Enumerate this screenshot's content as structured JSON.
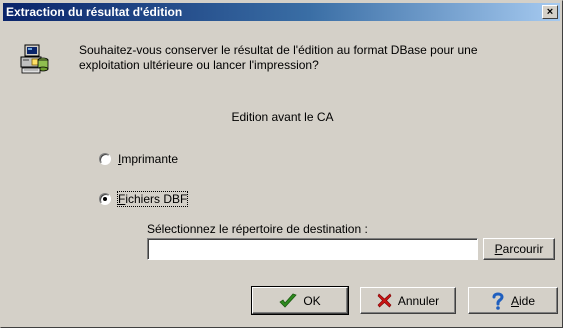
{
  "window": {
    "title": "Extraction du résultat d'édition",
    "close_label": "×"
  },
  "message": "Souhaitez-vous conserver le résultat de l'édition au format DBase pour une exploitation ultérieure ou lancer l'impression?",
  "subtitle": "Edition avant le CA",
  "options": {
    "printer": {
      "access_key": "I",
      "rest": "mprimante",
      "checked": false
    },
    "dbf": {
      "access_key": "F",
      "rest": "ichiers DBF",
      "checked": true
    }
  },
  "destination": {
    "label": "Sélectionnez le répertoire de destination :",
    "value": "",
    "browse_key": "P",
    "browse_rest": "arcourir"
  },
  "buttons": {
    "ok_label": "OK",
    "cancel_label": "Annuler",
    "help_prefix": "",
    "help_key": "A",
    "help_rest": "ide"
  },
  "icons": {
    "app": "computer-database-icon",
    "ok": "checkmark-icon",
    "cancel": "x-icon",
    "help": "question-mark-icon"
  },
  "colors": {
    "titlebar_start": "#0a246a",
    "titlebar_end": "#a6caf0",
    "face": "#d4d0c8",
    "ok_green": "#2e8b1f",
    "cancel_red": "#c81414",
    "help_blue": "#1f5fbf"
  }
}
